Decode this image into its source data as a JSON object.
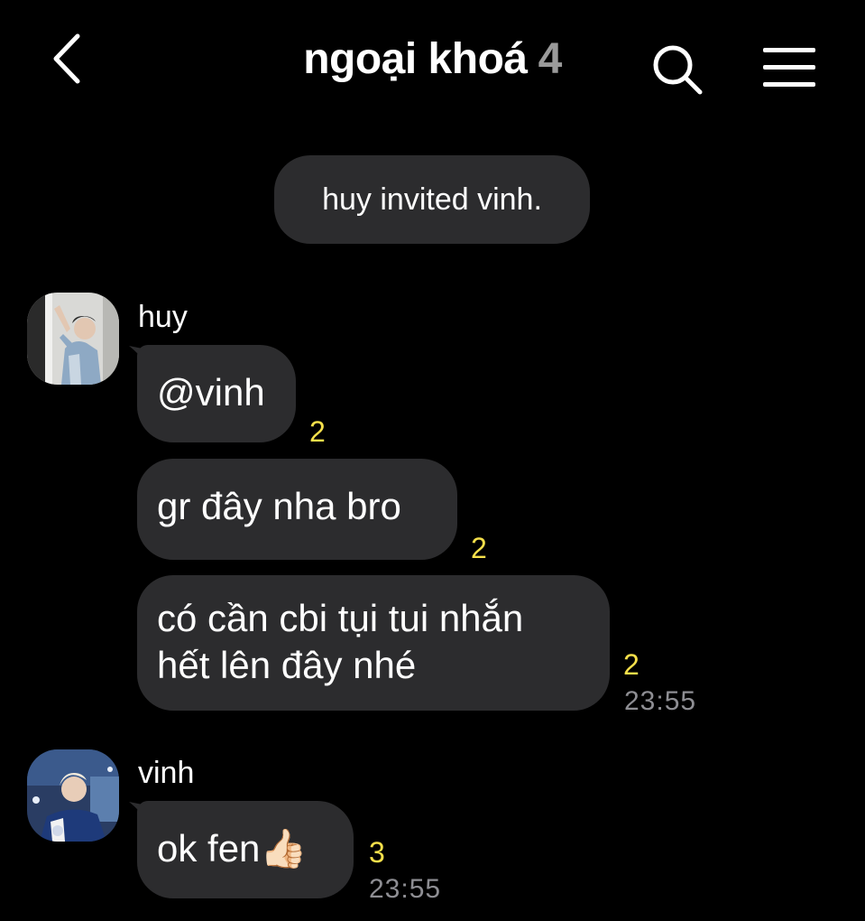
{
  "header": {
    "chat_name": "ngoại khoá",
    "member_count": "4"
  },
  "system": {
    "notice": "huy invited vinh."
  },
  "groups": [
    {
      "sender": "huy",
      "messages": [
        {
          "text": "@vinh",
          "unread": "2"
        },
        {
          "text": "gr đây nha bro",
          "unread": "2"
        },
        {
          "line1": "có cần cbi tụi tui nhắn",
          "line2": "hết lên đây nhé",
          "unread": "2",
          "time": "23:55"
        }
      ]
    },
    {
      "sender": "vinh",
      "messages": [
        {
          "text": "ok fen👍🏻",
          "unread": "3",
          "time": "23:55"
        }
      ]
    }
  ],
  "colors": {
    "background": "#000000",
    "bubble": "#2c2c2e",
    "unread": "#f6e04b",
    "timestamp": "#8e8e93",
    "member_count": "#9a9a9a"
  },
  "icons": {
    "back": "chevron-left-icon",
    "search": "search-icon",
    "menu": "hamburger-menu-icon"
  }
}
